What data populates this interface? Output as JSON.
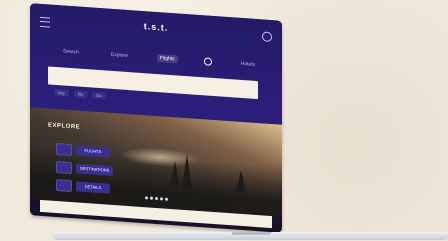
{
  "colors": {
    "background": "#f1e9dc",
    "header": "#241a68",
    "accent": "#3a2f8e",
    "text_light": "#bdb4f2"
  },
  "header": {
    "logo": "t.s.t.",
    "menu_icon": "menu-icon",
    "settings_icon": "gear-icon"
  },
  "nav": {
    "items": [
      {
        "label": "Search",
        "active": false
      },
      {
        "label": "Explore",
        "active": false
      },
      {
        "label": "Flights",
        "active": true
      },
      {
        "label": "",
        "active": false,
        "icon": "circle-icon"
      },
      {
        "label": "Hotels",
        "active": false
      }
    ]
  },
  "search": {
    "placeholder": ""
  },
  "pills": [
    {
      "label": "Any"
    },
    {
      "label": "Fly"
    },
    {
      "label": "Go"
    }
  ],
  "hero": {
    "title": "EXPLORE",
    "buttons": [
      {
        "label": "FLIGHTS"
      },
      {
        "label": "DESTINATIONS"
      },
      {
        "label": "DETAILS"
      }
    ],
    "carousel_dots": 5
  },
  "footer": {
    "bar_text": ""
  }
}
